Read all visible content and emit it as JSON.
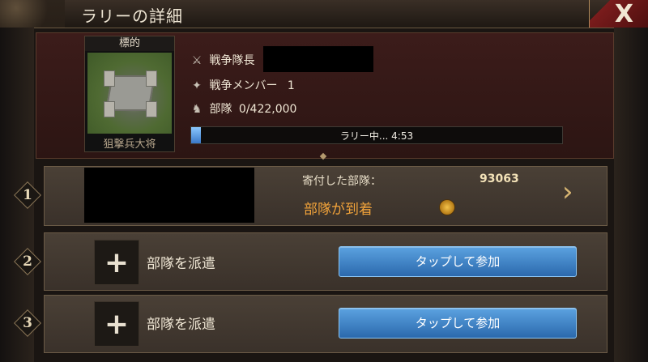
{
  "header": {
    "title": "ラリーの詳細",
    "close_icon": "close-icon"
  },
  "target": {
    "label": "標的",
    "name": "狙撃兵大将"
  },
  "info": {
    "leader_label": "戦争隊長",
    "members_label": "戦争メンバー",
    "members_count": "1",
    "troops_label": "部隊",
    "troops_value": "0/422,000"
  },
  "progress": {
    "text": "ラリー中... 4:53",
    "fraction": 0.02
  },
  "slots": [
    {
      "number": "1",
      "donated_label": "寄付した部隊：",
      "donated_value": "93063",
      "status": "部隊が到着"
    },
    {
      "number": "2",
      "dispatch_label": "部隊を派遣",
      "join_label": "タップして参加"
    },
    {
      "number": "3",
      "dispatch_label": "部隊を派遣",
      "join_label": "タップして参加"
    }
  ],
  "colors": {
    "accent_blue": "#3a78c8",
    "arrival_orange": "#f0a23a",
    "panel_maroon": "#3c1c1a"
  }
}
